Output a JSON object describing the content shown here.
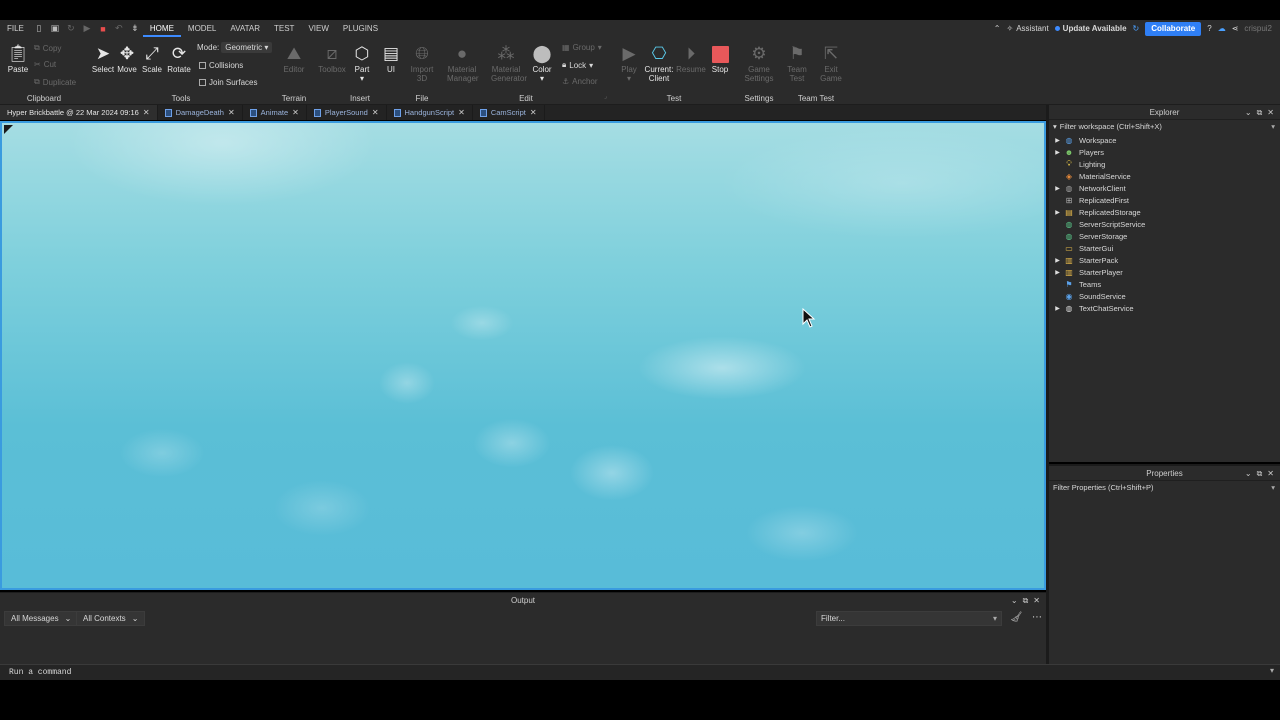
{
  "menubar": {
    "items": [
      "FILE",
      "HOME",
      "MODEL",
      "AVATAR",
      "TEST",
      "VIEW",
      "PLUGINS"
    ],
    "active": "HOME",
    "assistant": "Assistant",
    "update": "Update Available",
    "collaborate": "Collaborate",
    "username": "crispui2"
  },
  "ribbon": {
    "clipboard": {
      "label": "Clipboard",
      "paste": "Paste",
      "copy": "Copy",
      "cut": "Cut",
      "duplicate": "Duplicate"
    },
    "tools": {
      "label": "Tools",
      "select": "Select",
      "move": "Move",
      "scale": "Scale",
      "rotate": "Rotate",
      "mode_label": "Mode:",
      "mode_value": "Geometric",
      "collisions": "Collisions",
      "join_surfaces": "Join Surfaces"
    },
    "terrain": {
      "label": "Terrain",
      "editor": "Editor"
    },
    "insert": {
      "label": "Insert",
      "toolbox": "Toolbox",
      "part": "Part",
      "ui": "UI"
    },
    "file": {
      "label": "File",
      "import3d_line1": "Import",
      "import3d_line2": "3D"
    },
    "edit": {
      "label": "Edit",
      "material_manager_1": "Material",
      "material_manager_2": "Manager",
      "material_generator_1": "Material",
      "material_generator_2": "Generator",
      "color": "Color",
      "group": "Group",
      "lock": "Lock",
      "anchor": "Anchor"
    },
    "test": {
      "label": "Test",
      "play": "Play",
      "current_client_1": "Current:",
      "current_client_2": "Client",
      "resume": "Resume",
      "stop": "Stop"
    },
    "settings": {
      "label": "Settings",
      "game_settings_1": "Game",
      "game_settings_2": "Settings"
    },
    "team_test": {
      "label": "Team Test",
      "team_test_1": "Team",
      "team_test_2": "Test",
      "exit_game_1": "Exit",
      "exit_game_2": "Game"
    }
  },
  "tabs": [
    {
      "label": "Hyper Brickbattle @ 22 Mar 2024 09:16",
      "active": true
    },
    {
      "label": "DamageDeath",
      "active": false
    },
    {
      "label": "Animate",
      "active": false
    },
    {
      "label": "PlayerSound",
      "active": false
    },
    {
      "label": "HandgunScript",
      "active": false
    },
    {
      "label": "CamScript",
      "active": false
    }
  ],
  "output": {
    "title": "Output",
    "messages_filter": "All Messages",
    "contexts_filter": "All Contexts",
    "filter_placeholder": "Filter..."
  },
  "command_bar": {
    "placeholder": "Run a command"
  },
  "explorer": {
    "title": "Explorer",
    "filter": "Filter workspace (Ctrl+Shift+X)",
    "items": [
      {
        "name": "Workspace",
        "expandable": true,
        "icon": "globe-icon",
        "color": "#5aa0e8"
      },
      {
        "name": "Players",
        "expandable": true,
        "icon": "players-icon",
        "color": "#7bc86a"
      },
      {
        "name": "Lighting",
        "expandable": false,
        "icon": "lightbulb-icon",
        "color": "#f2d04a"
      },
      {
        "name": "MaterialService",
        "expandable": false,
        "icon": "material-icon",
        "color": "#e88a3a"
      },
      {
        "name": "NetworkClient",
        "expandable": true,
        "icon": "network-icon",
        "color": "#a0a0a0"
      },
      {
        "name": "ReplicatedFirst",
        "expandable": false,
        "icon": "replicated-first-icon",
        "color": "#b0b0b0"
      },
      {
        "name": "ReplicatedStorage",
        "expandable": true,
        "icon": "storage-icon",
        "color": "#e6b84a"
      },
      {
        "name": "ServerScriptService",
        "expandable": false,
        "icon": "server-script-icon",
        "color": "#5ac88a"
      },
      {
        "name": "ServerStorage",
        "expandable": false,
        "icon": "server-storage-icon",
        "color": "#5ac88a"
      },
      {
        "name": "StarterGui",
        "expandable": false,
        "icon": "gui-icon",
        "color": "#e6b84a"
      },
      {
        "name": "StarterPack",
        "expandable": true,
        "icon": "backpack-icon",
        "color": "#e6b84a"
      },
      {
        "name": "StarterPlayer",
        "expandable": true,
        "icon": "starter-player-icon",
        "color": "#e6b84a"
      },
      {
        "name": "Teams",
        "expandable": false,
        "icon": "teams-icon",
        "color": "#5aa0e8"
      },
      {
        "name": "SoundService",
        "expandable": false,
        "icon": "sound-icon",
        "color": "#5aa0e8"
      },
      {
        "name": "TextChatService",
        "expandable": true,
        "icon": "chat-icon",
        "color": "#d8d8d8"
      }
    ]
  },
  "properties": {
    "title": "Properties",
    "filter": "Filter Properties (Ctrl+Shift+P)"
  }
}
